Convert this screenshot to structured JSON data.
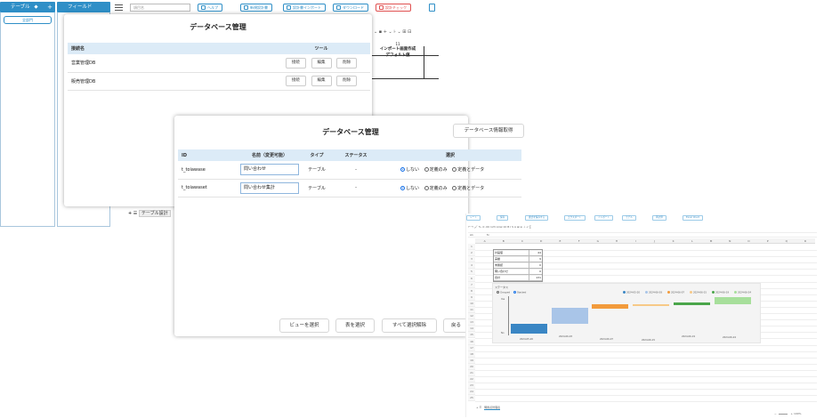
{
  "left_panel": {
    "tab_label": "テーブル",
    "add_glyph": "+",
    "item_label": "全部門"
  },
  "field_panel": {
    "tab_label": "フィールド"
  },
  "toolbar": {
    "search_placeholder": "項目名",
    "buttons": [
      {
        "label": "ヘルプ",
        "variant": "blue"
      },
      {
        "label": "新規設計書",
        "variant": "blue"
      },
      {
        "label": "設計書インポート",
        "variant": "blue"
      },
      {
        "label": "ダウンロード",
        "variant": "blue"
      },
      {
        "label": "設計チェック",
        "variant": "red"
      }
    ]
  },
  "bg_sheet": {
    "line1": "11",
    "line2": "インポート画面作成",
    "line3": "デフォルト値"
  },
  "bg_bottom_tab": "テーブル設計",
  "dialog1": {
    "title": "データベース管理",
    "columns": [
      "接続名",
      "ツール"
    ],
    "rows": [
      {
        "name": "営業管理DB",
        "tools": [
          "接続",
          "編集",
          "削除"
        ]
      },
      {
        "name": "販売管理DB",
        "tools": [
          "接続",
          "編集",
          "削除"
        ]
      }
    ]
  },
  "dialog2": {
    "title": "データベース管理",
    "info_button": "データベース情報取得",
    "columns": [
      "ID",
      "名前（変更可能）",
      "タイプ",
      "ステータス",
      "選択"
    ],
    "options": [
      "しない",
      "定義のみ",
      "定義とデータ"
    ],
    "rows": [
      {
        "id": "t_toiawase",
        "name": "問い合わせ",
        "type": "テーブル",
        "status": "-",
        "selected": 0
      },
      {
        "id": "t_toiawaset",
        "name": "問い合わせ集計",
        "type": "テーブル",
        "status": "-",
        "selected": 0
      }
    ],
    "footer_buttons": [
      "ビューを選択",
      "表を選択",
      "すべて選択解除",
      "戻る"
    ]
  },
  "spreadsheet": {
    "toolbar_buttons": [
      "シート",
      "保存",
      "書式を保存する",
      "エクスポート",
      "インポート",
      "モデル",
      "再計算",
      "Excel Chart"
    ],
    "cell_ref": "A1",
    "columns": [
      "A",
      "B",
      "C",
      "D",
      "E",
      "F",
      "G",
      "H",
      "I",
      "J",
      "K",
      "L",
      "M",
      "N",
      "O",
      "P",
      "Q",
      "R"
    ],
    "table_rows": [
      {
        "label": "計画値",
        "value": "44"
      },
      {
        "label": "実績",
        "value": "9"
      },
      {
        "label": "未確認",
        "value": "0"
      },
      {
        "label": "問い合わせ",
        "value": "0"
      },
      {
        "label": "合計",
        "value": "131"
      }
    ],
    "sheet_tab": "問題点管理表",
    "zoom": "100%",
    "chart": {
      "title": "ステータス",
      "legend_left": [
        "Grouped",
        "Stacked"
      ],
      "series_legend": [
        "2024-05-20",
        "2024-06-03",
        "2024-06-07",
        "2024-06-15",
        "2024-06-19",
        "2024-06-24"
      ],
      "series_colors": [
        "#3a86c4",
        "#a9c5e8",
        "#f29b3c",
        "#f7c987",
        "#4aa64a",
        "#a7df9b"
      ],
      "y_labels": [
        "Yes",
        "No"
      ],
      "x_labels": [
        "2024-05-20",
        "2024-06-03",
        "2024-06-07",
        "2024-06-15",
        "2024-06-19",
        "2024-06-24"
      ]
    }
  }
}
